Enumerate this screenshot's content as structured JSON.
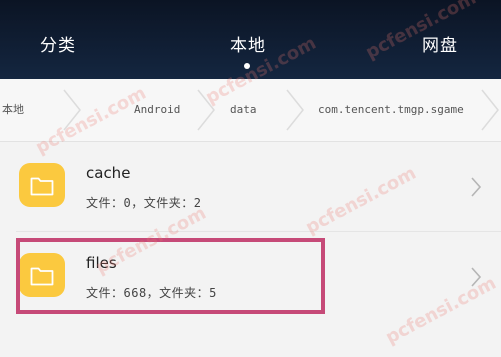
{
  "tabs": [
    {
      "label": "分类"
    },
    {
      "label": "本地"
    },
    {
      "label": "网盘"
    }
  ],
  "active_tab_index": 1,
  "breadcrumb": [
    {
      "label": "本地"
    },
    {
      "label": "Android"
    },
    {
      "label": "data"
    },
    {
      "label": "com.tencent.tmgp.sgame"
    }
  ],
  "items": [
    {
      "name": "cache",
      "meta": "文件：0，文件夹：2",
      "icon": "folder-icon",
      "highlighted": false
    },
    {
      "name": "files",
      "meta": "文件：668，文件夹：5",
      "icon": "folder-icon",
      "highlighted": true
    }
  ],
  "colors": {
    "topbar": "#0b1424",
    "folder": "#fbc93f",
    "highlight": "#c64a78"
  },
  "watermark": "pcfensi.com"
}
